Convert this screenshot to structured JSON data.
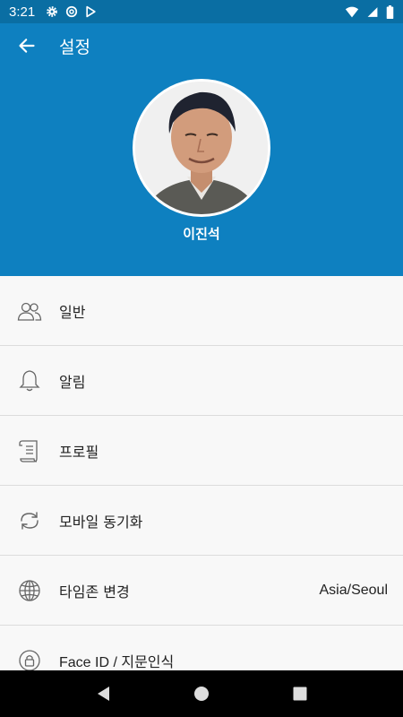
{
  "status_bar": {
    "time": "3:21"
  },
  "header": {
    "title": "설정",
    "user_name": "이진석"
  },
  "settings": [
    {
      "label": "일반",
      "icon": "users-icon"
    },
    {
      "label": "알림",
      "icon": "bell-icon"
    },
    {
      "label": "프로필",
      "icon": "scroll-icon"
    },
    {
      "label": "모바일 동기화",
      "icon": "sync-icon"
    },
    {
      "label": "타임존 변경",
      "icon": "globe-icon",
      "value": "Asia/Seoul"
    },
    {
      "label": "Face ID / 지문인식",
      "icon": "lock-icon"
    }
  ],
  "colors": {
    "header": "#0e80c0",
    "status_bar": "#0a6ea3",
    "background": "#f8f8f8"
  }
}
